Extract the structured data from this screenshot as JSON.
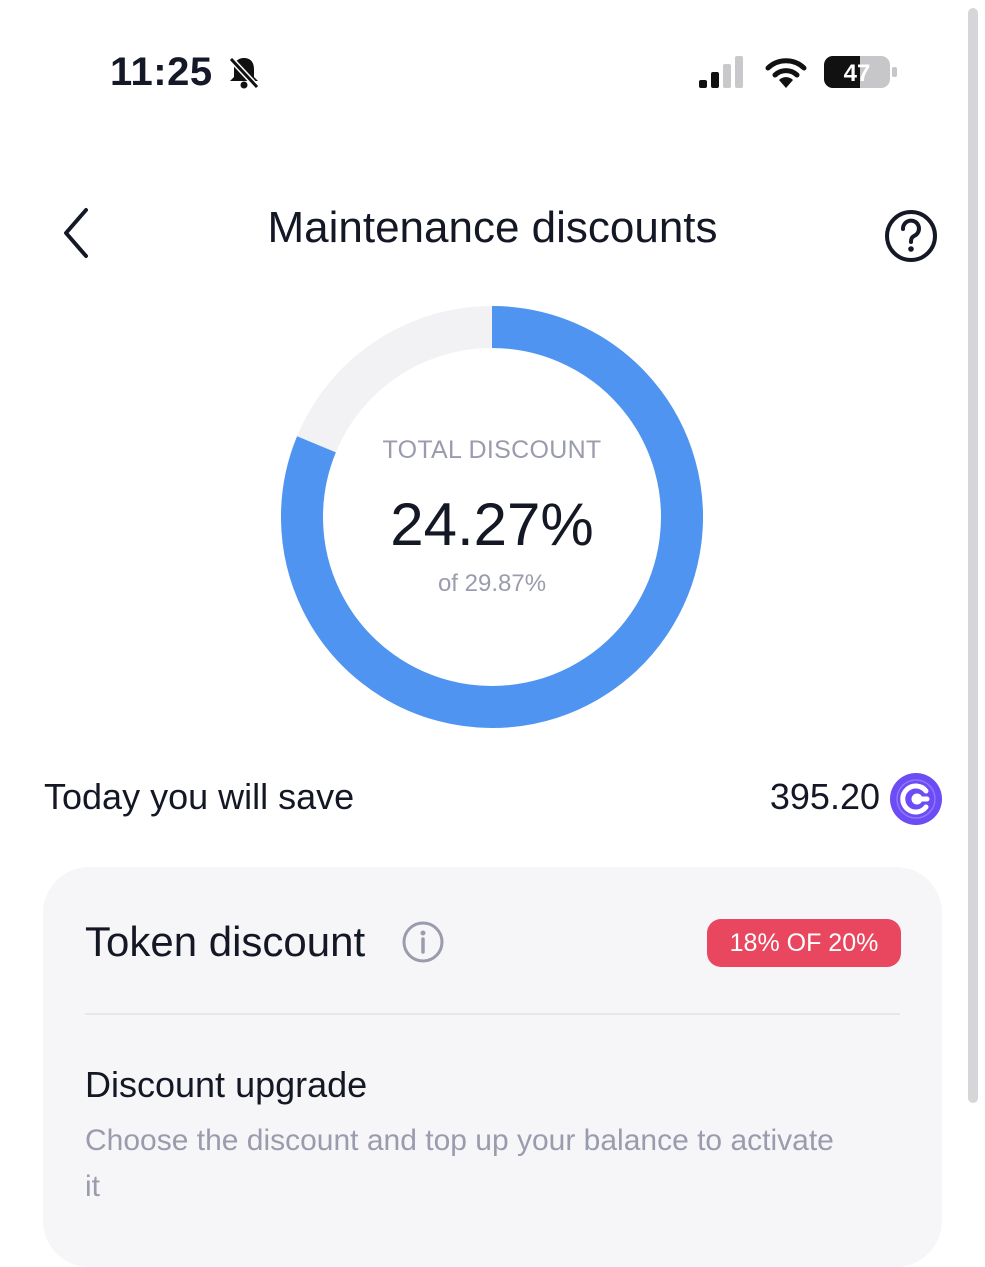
{
  "status_bar": {
    "time": "11:25",
    "battery": "47",
    "icons": [
      "bell-slash-icon",
      "cellular-signal-icon",
      "wifi-icon",
      "battery-icon"
    ]
  },
  "header": {
    "title": "Maintenance discounts",
    "back_icon": "chevron-left-icon",
    "help_icon": "question-circle-icon"
  },
  "discount_ring": {
    "label": "TOTAL DISCOUNT",
    "value": "24.27%",
    "sub": "of 29.87%",
    "progress_fraction": 0.8125,
    "colors": {
      "progress": "#4f94f0",
      "track": "#f2f2f4"
    }
  },
  "savings": {
    "label": "Today you will save",
    "amount": "395.20",
    "coin_icon": "token-coin-icon",
    "coin_color": "#6c4cf5"
  },
  "token_card": {
    "title": "Token discount",
    "info_icon": "info-circle-icon",
    "badge": "18% OF 20%",
    "badge_color": "#e9475f",
    "upgrade_title": "Discount upgrade",
    "upgrade_desc": "Choose the discount and top up your balance to activate it"
  }
}
